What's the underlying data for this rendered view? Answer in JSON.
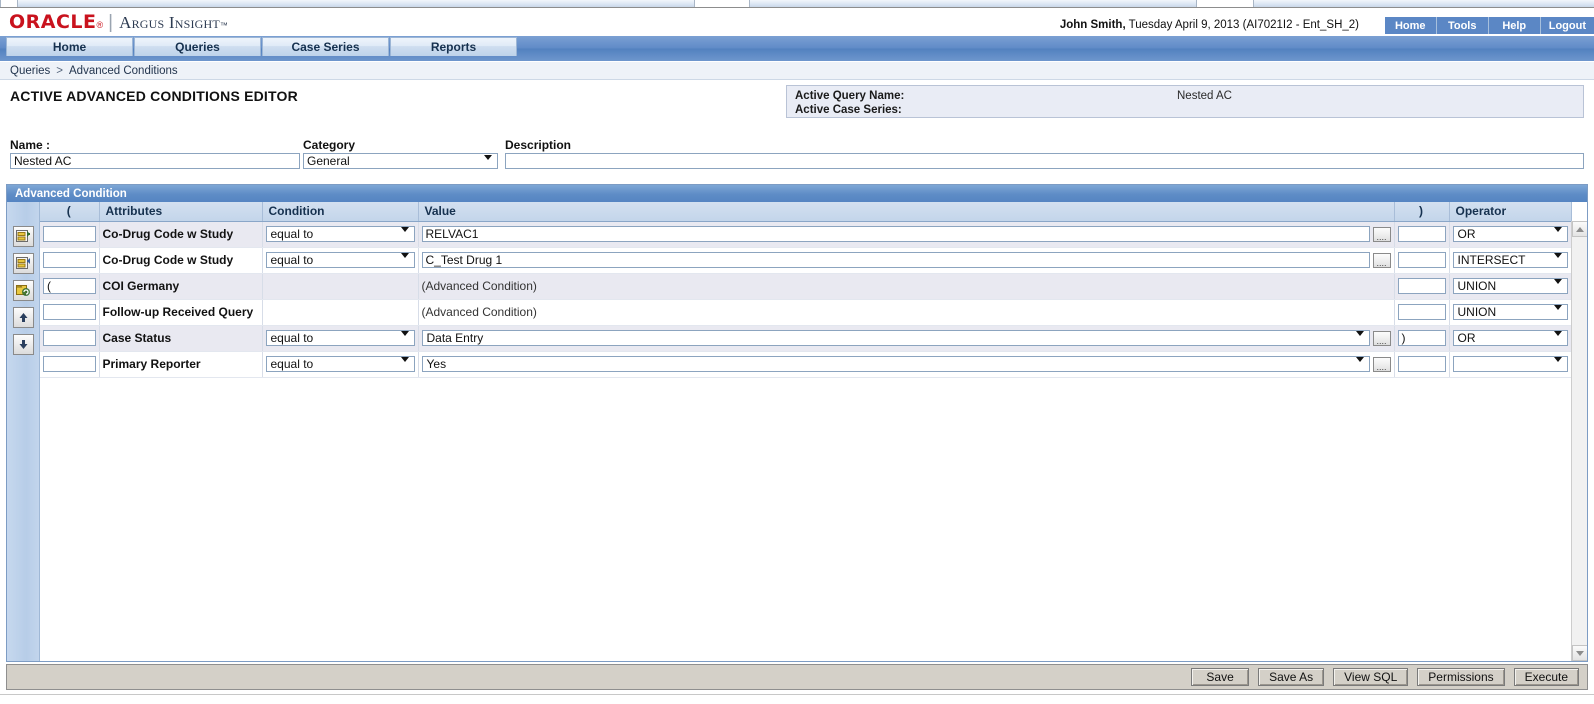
{
  "brand": {
    "oracle": "ORACLE",
    "registered": "®",
    "product": "Argus Insight",
    "trademark": "™"
  },
  "header": {
    "user_name": "John Smith,",
    "session_info": " Tuesday April 9, 2013 (AI7021I2 - Ent_SH_2)",
    "top_links": [
      {
        "label": "Home",
        "name": "top-link-home"
      },
      {
        "label": "Tools",
        "name": "top-link-tools"
      },
      {
        "label": "Help",
        "name": "top-link-help"
      },
      {
        "label": "Logout",
        "name": "top-link-logout"
      }
    ]
  },
  "nav_tabs": [
    {
      "label": "Home"
    },
    {
      "label": "Queries"
    },
    {
      "label": "Case Series"
    },
    {
      "label": "Reports"
    }
  ],
  "breadcrumb": {
    "root": "Queries",
    "separator": ">",
    "current": "Advanced Conditions"
  },
  "page": {
    "title": "ACTIVE ADVANCED CONDITIONS EDITOR"
  },
  "active_info": {
    "query_name_label": "Active Query Name:",
    "case_series_label": "Active Case Series:",
    "query_name_value": "Nested AC",
    "case_series_value": ""
  },
  "meta": {
    "name_label": "Name :",
    "name_value": "Nested AC",
    "category_label": "Category",
    "category_value": "General",
    "description_label": "Description",
    "description_value": ""
  },
  "advanced_condition": {
    "caption": "Advanced Condition",
    "columns": {
      "tools": "",
      "open_paren": "(",
      "attributes": "Attributes",
      "condition": "Condition",
      "value": "Value",
      "close_paren": ")",
      "operator": "Operator"
    },
    "tool_buttons": [
      {
        "name": "add-condition-icon",
        "title": "Add Condition"
      },
      {
        "name": "delete-condition-icon",
        "title": "Delete Condition"
      },
      {
        "name": "add-nested-advanced-condition-icon",
        "title": "Add Advanced Condition"
      },
      {
        "name": "move-row-up-icon",
        "title": "Move Up"
      },
      {
        "name": "move-row-down-icon",
        "title": "Move Down"
      }
    ],
    "rows": [
      {
        "open_paren": "",
        "attribute": "Co-Drug Code w Study",
        "condition": "equal to",
        "has_condition_select": true,
        "value": "RELVAC1",
        "value_kind": "text",
        "has_browse": true,
        "close_paren": "",
        "operator": "OR",
        "has_operator_select": true,
        "shade": "alt"
      },
      {
        "open_paren": "",
        "attribute": "Co-Drug Code w Study",
        "condition": "equal to",
        "has_condition_select": true,
        "value": "C_Test Drug 1",
        "value_kind": "text",
        "has_browse": true,
        "close_paren": "",
        "operator": "INTERSECT",
        "has_operator_select": true,
        "shade": "norm"
      },
      {
        "open_paren": "(",
        "attribute": "COI Germany",
        "condition": "",
        "has_condition_select": false,
        "value": "(Advanced Condition)",
        "value_kind": "static",
        "has_browse": false,
        "close_paren": "",
        "operator": "UNION",
        "has_operator_select": true,
        "shade": "alt"
      },
      {
        "open_paren": "",
        "attribute": "Follow-up Received Query",
        "condition": "",
        "has_condition_select": false,
        "value": "(Advanced Condition)",
        "value_kind": "static",
        "has_browse": false,
        "close_paren": "",
        "operator": "UNION",
        "has_operator_select": true,
        "shade": "norm"
      },
      {
        "open_paren": "",
        "attribute": "Case Status",
        "condition": "equal to",
        "has_condition_select": true,
        "value": "Data Entry",
        "value_kind": "select",
        "has_browse": true,
        "close_paren": ")",
        "operator": "OR",
        "has_operator_select": true,
        "shade": "alt"
      },
      {
        "open_paren": "",
        "attribute": "Primary Reporter",
        "condition": "equal to",
        "has_condition_select": true,
        "value": "Yes",
        "value_kind": "select",
        "has_browse": true,
        "close_paren": "",
        "operator": "",
        "has_operator_select": true,
        "shade": "norm"
      }
    ]
  },
  "footer_buttons": [
    {
      "label": "Save",
      "name": "save-button"
    },
    {
      "label": "Save As",
      "name": "save-as-button"
    },
    {
      "label": "View SQL",
      "name": "view-sql-button"
    },
    {
      "label": "Permissions",
      "name": "permissions-button"
    },
    {
      "label": "Execute",
      "name": "execute-button"
    }
  ],
  "colors": {
    "brand_red": "#c9121d",
    "nav_blue": "#5b87c5",
    "panel_caption": "#5e8cc6",
    "row_alt": "#e9e9f1",
    "toolbar_blue": "#b7cde8"
  }
}
